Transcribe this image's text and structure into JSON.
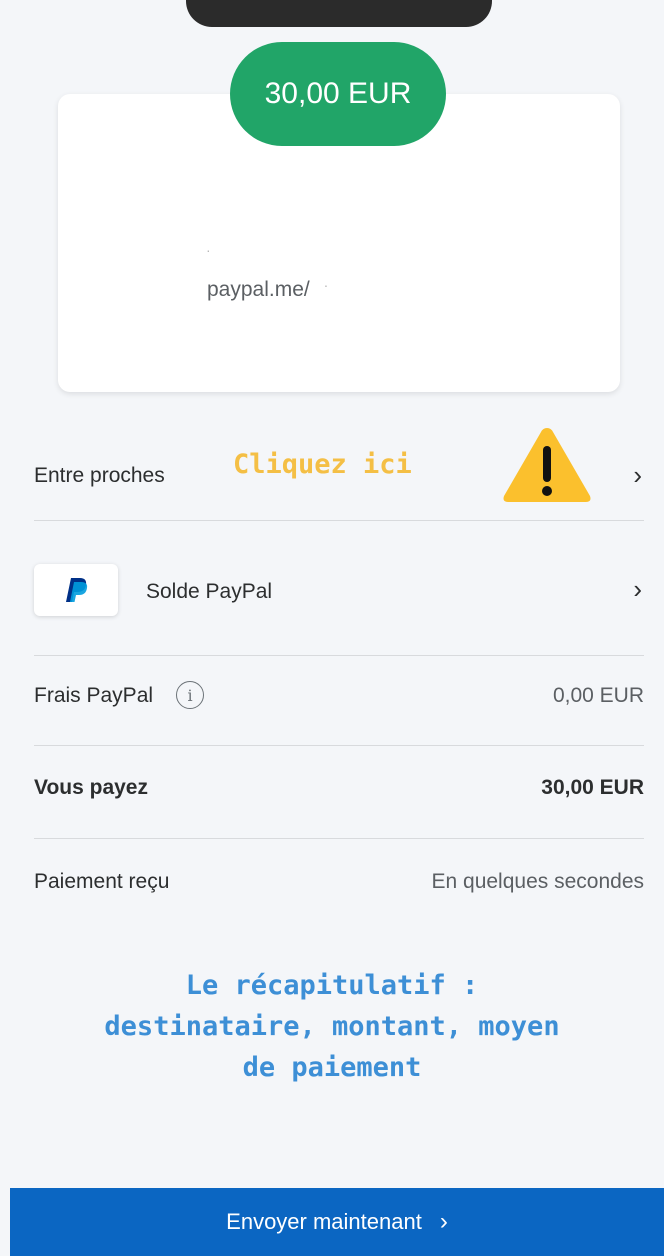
{
  "header": {
    "amount": "30,00 EUR"
  },
  "card": {
    "recipient": "paypal.me/"
  },
  "rows": {
    "entre_proches": {
      "label": "Entre proches",
      "annotation": "Cliquez ici",
      "chevron": "›"
    },
    "source": {
      "label": "Solde PayPal",
      "icon": "paypal-logo-icon",
      "chevron": "›"
    },
    "fees": {
      "label": "Frais PayPal",
      "info_icon": "i",
      "value": "0,00 EUR"
    },
    "total": {
      "label": "Vous payez",
      "value": "30,00 EUR"
    },
    "received": {
      "label": "Paiement reçu",
      "value": "En quelques secondes"
    }
  },
  "annotation": {
    "summary_line1": "Le récapitulatif :",
    "summary_line2": "destinataire, montant, moyen",
    "summary_line3": "de paiement"
  },
  "footer": {
    "send_label": "Envoyer maintenant",
    "send_arrow": "›"
  },
  "colors": {
    "amount_pill": "#21a568",
    "send_bar": "#0b66c2",
    "annotation_yellow": "#f4bf45",
    "annotation_blue": "#3d8fd6",
    "background": "#f4f6f9"
  }
}
